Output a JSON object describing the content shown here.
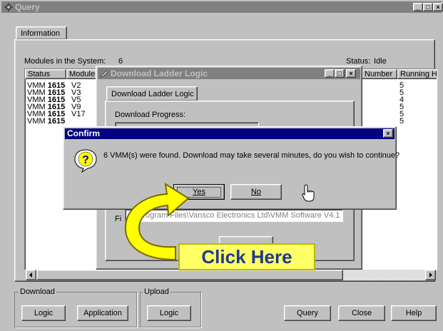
{
  "main_window": {
    "title": "Query",
    "controls": {
      "minimize": "_",
      "maximize": "□",
      "close": "×"
    },
    "tab_information": "Information",
    "modules_label": "Modules in the System:",
    "modules_count": "6",
    "status_label": "Status:",
    "status_value": "Idle",
    "columns": [
      "Status",
      "Module",
      "Number",
      "Running H"
    ],
    "rows": [
      {
        "status": "VMM",
        "model": "1615",
        "module": "V2",
        "running": "5"
      },
      {
        "status": "VMM",
        "model": "1615",
        "module": "V3",
        "running": "5"
      },
      {
        "status": "VMM",
        "model": "1615",
        "module": "V5",
        "running": "4"
      },
      {
        "status": "VMM",
        "model": "1615",
        "module": "V9",
        "running": "5"
      },
      {
        "status": "VMM",
        "model": "1615",
        "module": "V17",
        "running": "5"
      },
      {
        "status": "VMM",
        "model": "1615",
        "module": "",
        "running": "5"
      }
    ],
    "download_group": "Download",
    "upload_group": "Upload",
    "btn_logic": "Logic",
    "btn_application": "Application",
    "btn_upload_logic": "Logic",
    "btn_query": "Query",
    "btn_close": "Close",
    "btn_help": "Help"
  },
  "download_window": {
    "title": "Download Ladder Logic",
    "tab": "Download Ladder Logic",
    "progress_label": "Download Progress:",
    "file_label": "Fi",
    "file_path": "C:\\Program Files\\Vansco Electronics Ltd\\VMM Software V4.1"
  },
  "confirm_dialog": {
    "title": "Confirm",
    "message": "6 VMM(s) were found. Download may take several minutes, do you wish to continue?",
    "yes": "Yes",
    "no": "No",
    "close": "×"
  },
  "callout": {
    "text": "Click Here"
  },
  "colors": {
    "titlebar_inactive": "#808080",
    "titlebar_active": "#000080",
    "callout_fill": "#ffff66",
    "callout_text": "#1f3a8a",
    "arrow": "#ffff00"
  }
}
